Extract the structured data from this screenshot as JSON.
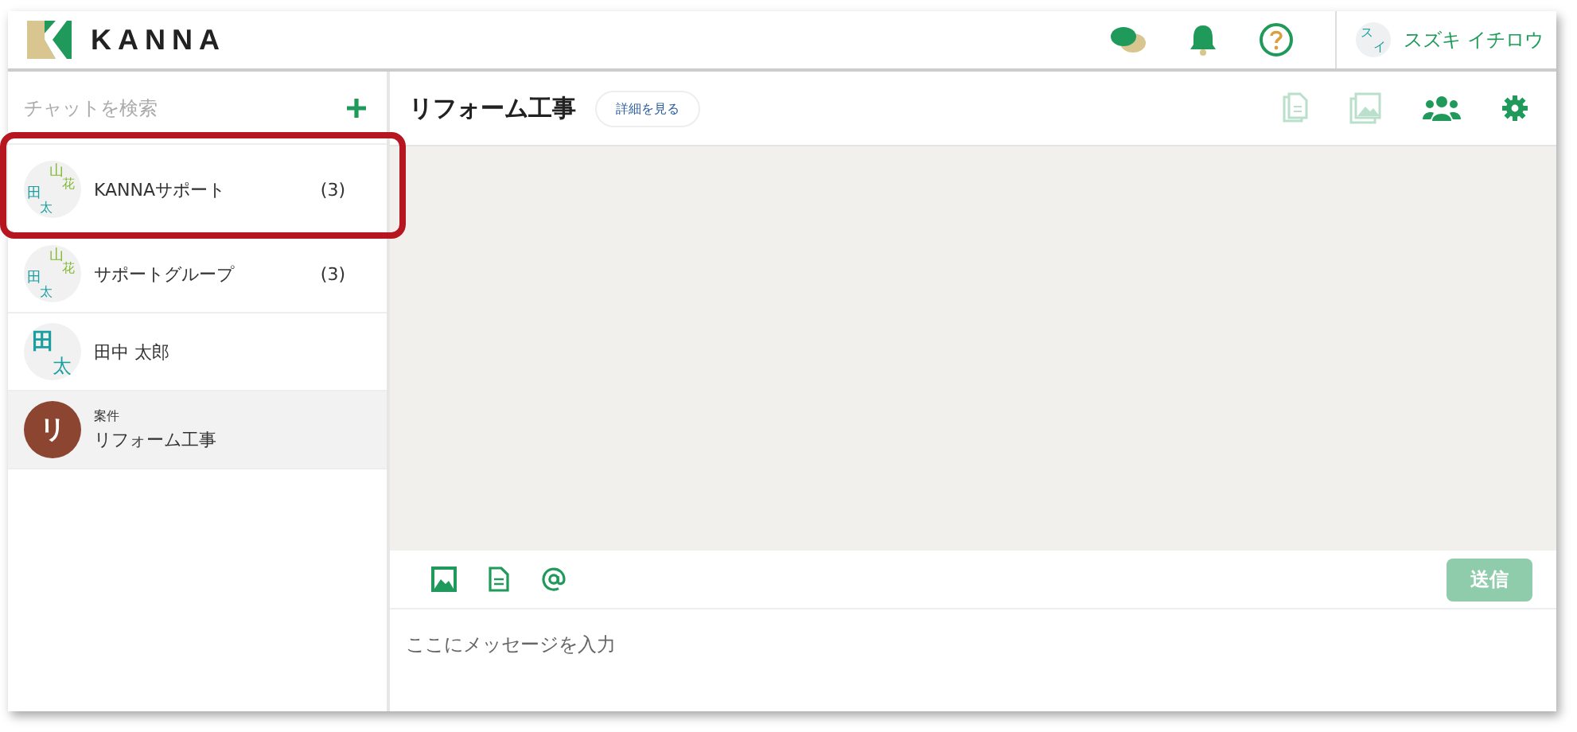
{
  "header": {
    "logo": "KANNA",
    "user": {
      "avatar": [
        "ス",
        "イ"
      ],
      "name": "スズキ イチロウ"
    }
  },
  "sidebar": {
    "search": {
      "placeholder": "チャットを検索"
    },
    "items": [
      {
        "kind": "group",
        "avatar": [
          "山",
          "花",
          "田",
          "太"
        ],
        "name": "KANNAサポート",
        "count": "(3)",
        "selected": false,
        "highlighted": true
      },
      {
        "kind": "group",
        "avatar": [
          "山",
          "花",
          "田",
          "太"
        ],
        "name": "サポートグループ",
        "count": "(3)",
        "selected": false,
        "highlighted": false
      },
      {
        "kind": "person",
        "avatar": [
          "田",
          "太"
        ],
        "name": "田中 太郎",
        "selected": false,
        "highlighted": false
      },
      {
        "kind": "project",
        "avatar": [
          "リ"
        ],
        "tag": "案件",
        "name": "リフォーム工事",
        "selected": true,
        "highlighted": false
      }
    ]
  },
  "chat": {
    "title": "リフォーム工事",
    "details_button": "詳細を見る",
    "tools": [
      {
        "kind": "files",
        "disabled": true
      },
      {
        "kind": "images",
        "disabled": true
      },
      {
        "kind": "members",
        "disabled": false
      },
      {
        "kind": "settings",
        "disabled": false
      }
    ],
    "send_button": {
      "label": "送信",
      "disabled": true
    },
    "message": {
      "placeholder": "ここにメッセージを入力"
    }
  }
}
